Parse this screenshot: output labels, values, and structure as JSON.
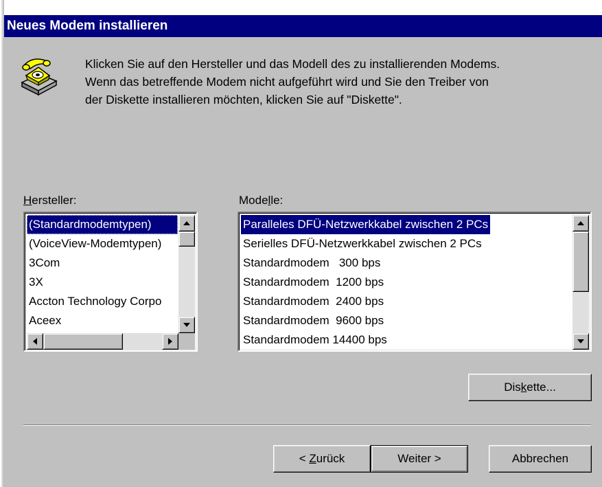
{
  "window": {
    "title": "Neues Modem installieren"
  },
  "intro": {
    "line1": "Klicken Sie auf den Hersteller und das Modell des zu installierenden Modems.",
    "line2": "Wenn das betreffende Modem nicht aufgeführt wird und Sie den Treiber von",
    "line3": "der Diskette installieren möchten, klicken Sie auf \"Diskette\"."
  },
  "manufacturers": {
    "label_mnemonic": "H",
    "label_rest": "ersteller:",
    "items": [
      "(Standardmodemtypen)",
      "(VoiceView-Modemtypen)",
      "3Com",
      "3X",
      "Accton Technology Corpo",
      "Aceex"
    ],
    "selected": "(Standardmodemtypen)"
  },
  "models": {
    "label_pre": "Mode",
    "label_mnemonic": "l",
    "label_post": "le:",
    "items": [
      "Paralleles DFÜ-Netzwerkkabel zwischen 2 PCs",
      "Serielles DFÜ-Netzwerkkabel zwischen 2 PCs",
      "Standardmodem   300 bps",
      "Standardmodem  1200 bps",
      "Standardmodem  2400 bps",
      "Standardmodem  9600 bps",
      "Standardmodem 14400 bps"
    ],
    "selected": "Paralleles DFÜ-Netzwerkkabel zwischen 2 PCs"
  },
  "buttons": {
    "disk_pre": "Dis",
    "disk_mnemonic": "k",
    "disk_post": "ette...",
    "back_pre": "< ",
    "back_mnemonic": "Z",
    "back_post": "urück",
    "next": "Weiter >",
    "cancel": "Abbrechen"
  },
  "icons": {
    "phone": "telephone-icon",
    "scroll_up": "arrow-up-icon",
    "scroll_down": "arrow-down-icon",
    "scroll_left": "arrow-left-icon",
    "scroll_right": "arrow-right-icon"
  },
  "colors": {
    "title_bar": "#000080",
    "face": "#c0c0c0",
    "selection": "#000080"
  }
}
